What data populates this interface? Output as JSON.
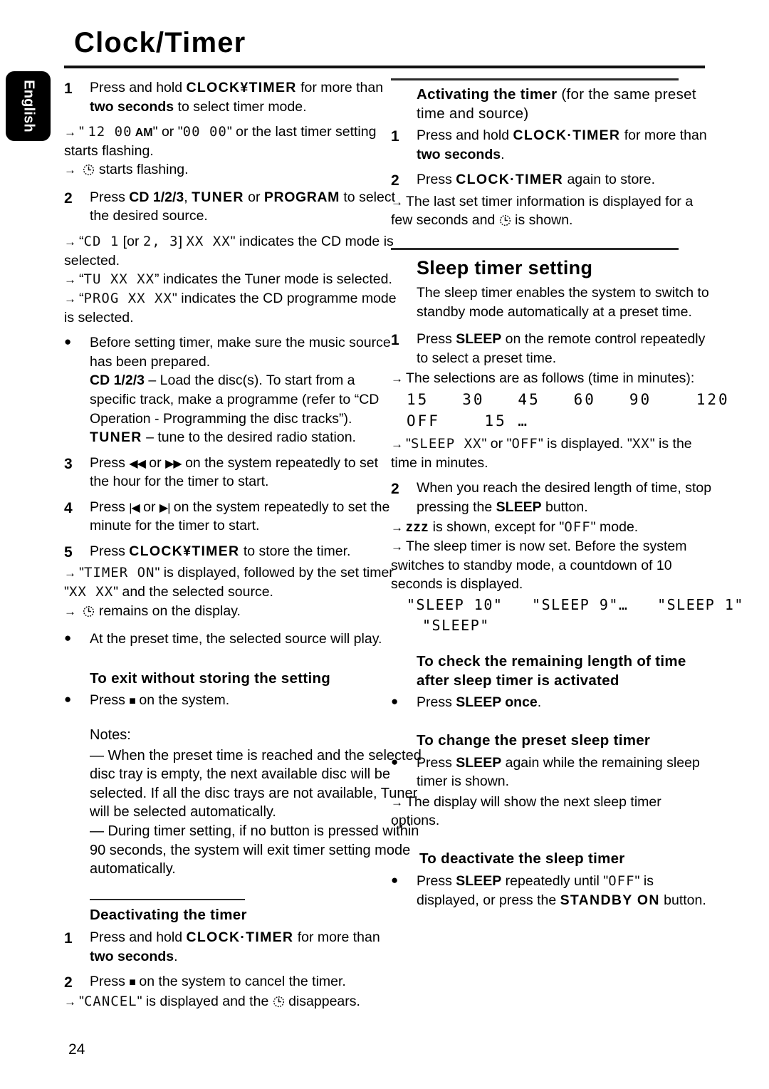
{
  "page": {
    "title": "Clock/Timer",
    "folio": "24",
    "language_tab": "English"
  },
  "icons": {
    "clock": "clock-icon",
    "arrow": "→",
    "bullet": "●",
    "stop": "■",
    "rew": "◀◀",
    "ffwd": "▶▶",
    "prev": "|◀",
    "next": "▶|"
  },
  "left_column": {
    "step1": {
      "num": "1",
      "t1": "Press and hold ",
      "b1": "CLOCK¥TIMER",
      "t2": " for more than ",
      "b2": "two seconds",
      "t3": " to select timer mode.",
      "sub1_pre": "\" ",
      "sub1_lcd": "12  00",
      "sub1_am": "AM",
      "sub1_mid": "\" or \"",
      "sub1_lcd2": "00  00",
      "sub1_post": "\" or the last timer setting starts flashing.",
      "sub2": " starts flashing."
    },
    "step2": {
      "num": "2",
      "t1": "Press ",
      "b1": "CD 1/2/3",
      "t2": ", ",
      "b2": "TUNER",
      "t3": " or ",
      "b3": "PROGRAM",
      "t4": " to select the desired source.",
      "sub1_open": "“",
      "sub1_lcd_a": "CD 1",
      "sub1_mid": " [or ",
      "sub1_lcd_b": "2, 3",
      "sub1_mid2": "] ",
      "sub1_lcd_c": "XX XX",
      "sub1_close": "\" indicates the CD mode is selected.",
      "sub2_open": "“",
      "sub2_lcd": "TU XX XX",
      "sub2_close": "” indicates the Tuner mode is selected.",
      "sub3_open": "“",
      "sub3_lcd": "PROG XX XX",
      "sub3_close": "\" indicates the CD programme mode is selected."
    },
    "bullet_prepare": {
      "marker": "●",
      "t1": "Before setting timer, make sure the music source has been prepared.",
      "b_cd": "CD 1/2/3",
      "t2": " – Load the disc(s). To start from a specific track, make a programme (refer to “CD Operation - Programming the disc tracks”).",
      "b_tuner": "TUNER",
      "t3": " – tune to the desired radio station."
    },
    "step3": {
      "num": "3",
      "t1": "Press ",
      "g1": "◀◀",
      "t2": " or ",
      "g2": "▶▶",
      "t3": "  on the system repeatedly to set the hour for the timer to start."
    },
    "step4": {
      "num": "4",
      "t1": "Press ",
      "g1": "|◀",
      "t2": " or ",
      "g2": "▶|",
      "t3": " on the system repeatedly to set the minute for the timer to start."
    },
    "step5": {
      "num": "5",
      "t1": "Press ",
      "b1": "CLOCK¥TIMER",
      "t2": " to store the timer.",
      "sub1_open": "\"",
      "sub1_lcd": "TIMER ON",
      "sub1_mid": "\" is displayed, followed by the set timer \"",
      "sub1_lcd2": "XX XX",
      "sub1_close": "\" and the selected source.",
      "sub2": " remains on the display."
    },
    "bullet_play": {
      "marker": "●",
      "text": "At the preset time, the selected source will play."
    },
    "exit_heading": "To exit without storing the setting",
    "exit_bullet": {
      "marker": "●",
      "t1": "Press ",
      "g1": "■",
      "t2": " on the system."
    },
    "notes": {
      "lead": "Notes:",
      "n1": "—  When the preset time is reached and the selected disc tray is empty, the next available disc will be selected.  If all the disc trays are not available, Tuner will be selected automatically.",
      "n2": "—  During timer setting, if no button is pressed within 90 seconds, the system will exit timer setting mode automatically."
    },
    "deactivating": {
      "heading": "Deactivating the timer",
      "step1": {
        "num": "1",
        "t1": "Press and hold ",
        "b1": "CLOCK·TIMER",
        "t2": " for more than ",
        "b2": "two seconds",
        "t3": "."
      },
      "step2": {
        "num": "2",
        "t1": "Press ",
        "g1": "■",
        "t2": "  on the system to cancel the timer.",
        "sub1_open": "\"",
        "sub1_lcd": "CANCEL",
        "sub1_mid": "\" is displayed and the ",
        "sub1_close": " disappears."
      }
    }
  },
  "right_column": {
    "activating": {
      "heading_bold": "Activating the timer",
      "heading_reg": " (for the same preset time and source)",
      "step1": {
        "num": "1",
        "t1": "Press and hold ",
        "b1": "CLOCK·TIMER",
        "t2": " for more than ",
        "b2": "two seconds",
        "t3": "."
      },
      "step2": {
        "num": "2",
        "t1": "Press ",
        "b1": "CLOCK·TIMER",
        "t2": " again to store.",
        "sub1_a": "The last set timer information is displayed for a few seconds and ",
        "sub1_b": " is shown."
      }
    },
    "sleep": {
      "heading": "Sleep timer setting",
      "intro": "The sleep timer enables the system to switch to standby mode automatically at a preset time.",
      "step1": {
        "num": "1",
        "t1": "Press ",
        "b1": "SLEEP",
        "t2": " on the remote control repeatedly to select a preset time.",
        "sub1": "The selections are as follows (time in minutes):",
        "lcd_row1": "15   30   45   60   90    120",
        "lcd_row2": "OFF    15 …",
        "sub2_open": "\"",
        "sub2_lcd": "SLEEP XX",
        "sub2_mid": "\" or \"",
        "sub2_lcd2": "OFF",
        "sub2_mid2": "\" is displayed. \"",
        "sub2_lcd3": "XX",
        "sub2_close": "\" is the time in minutes."
      },
      "step2": {
        "num": "2",
        "t1": "When you reach the desired length of time, stop pressing the ",
        "b1": "SLEEP",
        "t2": " button.",
        "sub1_zzz": "zzz",
        "sub1_mid": " is shown, except for \"",
        "sub1_lcd": "OFF",
        "sub1_close": "\" mode.",
        "sub2": "The sleep timer is now set. Before the system switches to standby mode, a countdown of 10 seconds is displayed.",
        "lcd_row1": "\"SLEEP 10\"   \"SLEEP 9\"…   \"SLEEP 1\"",
        "lcd_row2": "\"SLEEP\""
      }
    },
    "check_remaining": {
      "heading": "To check the remaining length of time after sleep timer is activated",
      "bullet": {
        "marker": "●",
        "t1": "Press ",
        "b1": "SLEEP once",
        "t2": "."
      }
    },
    "change_preset": {
      "heading": "To change the preset sleep timer",
      "bullet": {
        "marker": "●",
        "t1": "Press ",
        "b1": "SLEEP",
        "t2": " again while the remaining sleep timer is shown."
      },
      "sub1": "The display will show the next sleep timer options."
    },
    "deactivate_sleep": {
      "heading": "To deactivate the sleep timer",
      "bullet": {
        "marker": "●",
        "t1": "Press ",
        "b1": "SLEEP",
        "t2": " repeatedly until \"",
        "lcd": "OFF",
        "t3": "\" is displayed, or press the ",
        "b2": "STANDBY ON",
        "t4": " button."
      }
    }
  }
}
